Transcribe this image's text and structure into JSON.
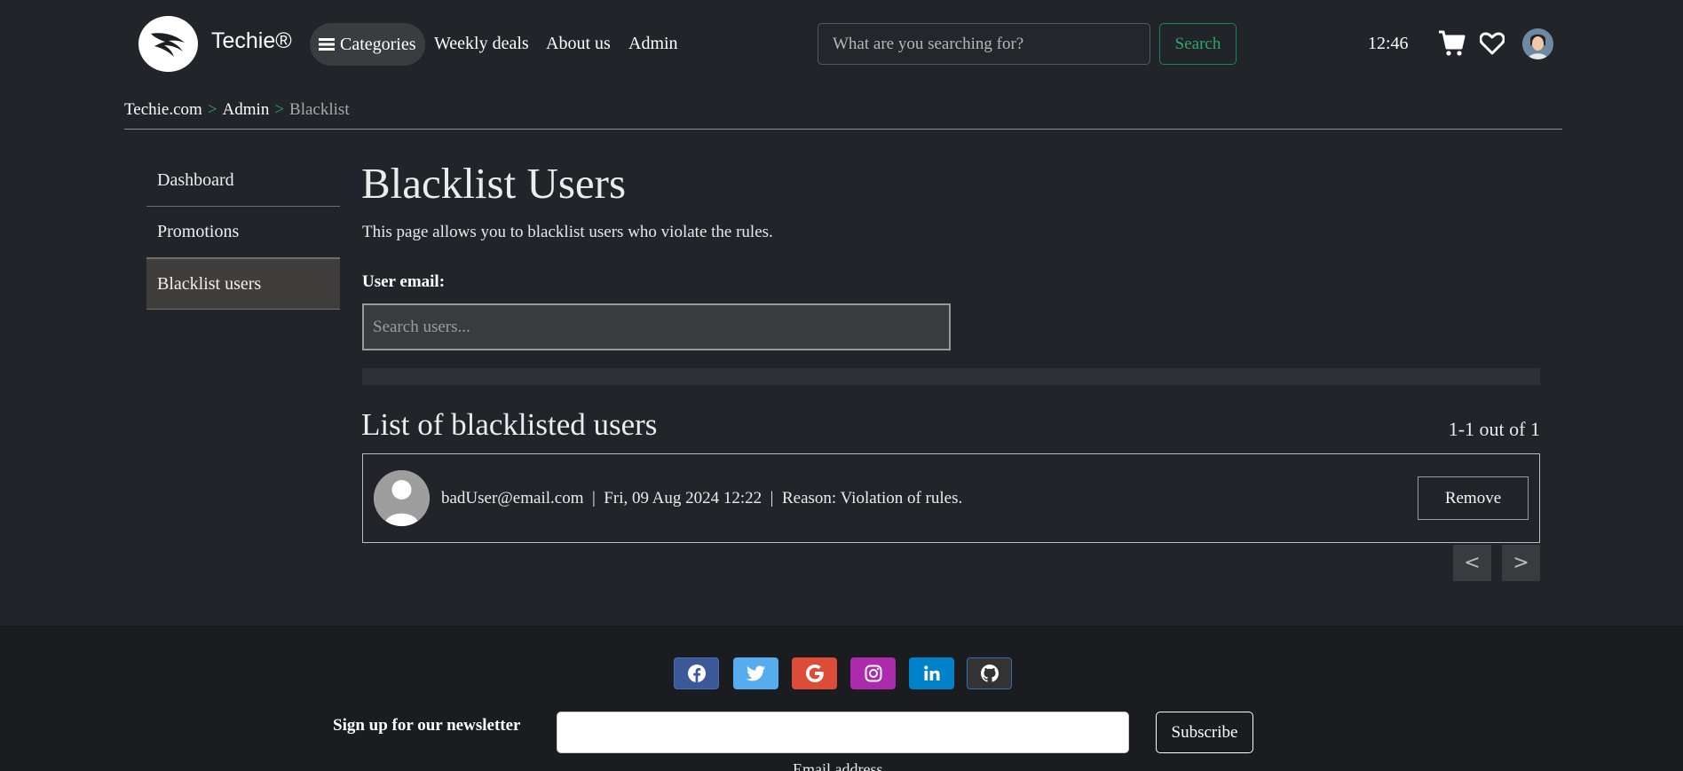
{
  "header": {
    "brand": "Techie®",
    "nav": {
      "categories": "Categories",
      "weekly_deals": "Weekly deals",
      "about": "About us",
      "admin": "Admin"
    },
    "search": {
      "placeholder": "What are you searching for?",
      "button": "Search"
    },
    "clock": "12:46",
    "icons": [
      "cart-icon",
      "heart-icon",
      "profile-avatar"
    ]
  },
  "breadcrumb": {
    "home": "Techie.com",
    "sep1": ">",
    "admin": "Admin",
    "sep2": ">",
    "current": "Blacklist"
  },
  "sidebar": {
    "items": [
      {
        "label": "Dashboard"
      },
      {
        "label": "Promotions"
      },
      {
        "label": "Blacklist users"
      }
    ]
  },
  "main": {
    "title": "Blacklist Users",
    "description": "This page allows you to blacklist users who violate the rules.",
    "email_label": "User email:",
    "search_placeholder": "Search users...",
    "list_title": "List of blacklisted users",
    "count": "1-1 out of 1",
    "entries": [
      {
        "email": "badUser@email.com",
        "date": "Fri, 09 Aug 2024 12:22",
        "reason": "Reason: Violation of rules.",
        "action": "Remove"
      }
    ],
    "pagination": {
      "prev": "<",
      "next": ">"
    }
  },
  "footer": {
    "social": [
      "facebook-icon",
      "twitter-icon",
      "google-icon",
      "instagram-icon",
      "linkedin-icon",
      "github-icon"
    ],
    "colors": {
      "facebook": "#3b5998",
      "twitter": "#55acee",
      "google": "#dd4b39",
      "instagram": "#ac2bac",
      "linkedin": "#0082ca",
      "github": "#333333"
    },
    "newsletter_label": "Sign up for our newsletter",
    "subscribe": "Subscribe",
    "email_caption": "Email address"
  },
  "colors": {
    "background": "#212429",
    "accent_green": "#198754",
    "footer_bg": "#1b1c1f"
  }
}
